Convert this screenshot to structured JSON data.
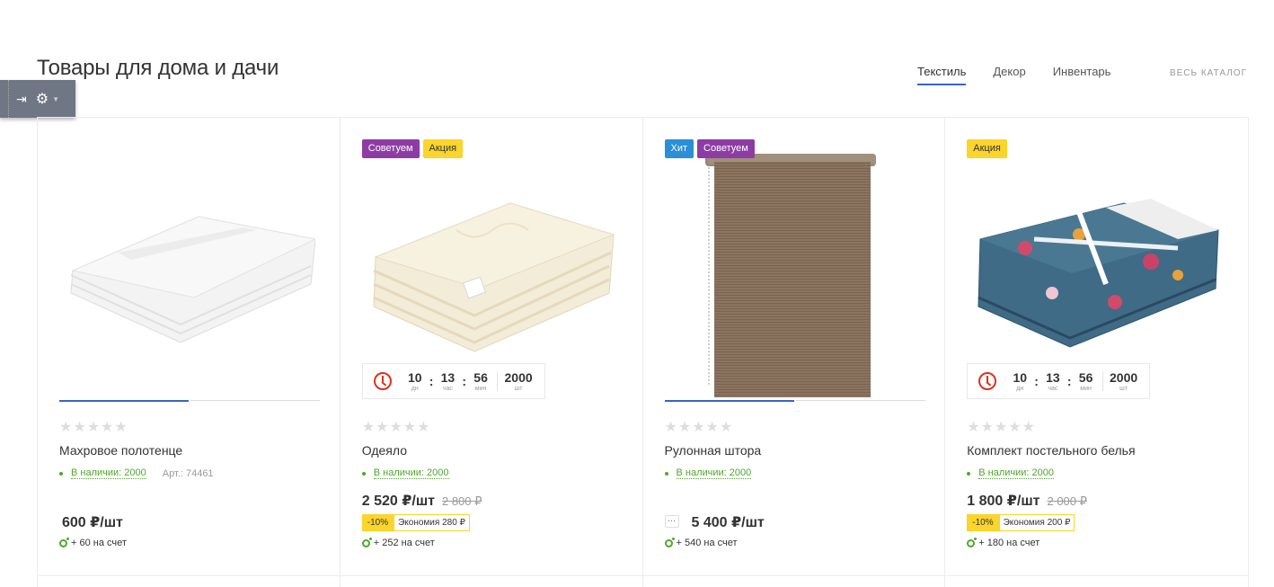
{
  "section": {
    "title": "Товары для дома и дачи",
    "tabs": [
      "Текстиль",
      "Декор",
      "Инвентарь"
    ],
    "active_tab": "Текстиль",
    "all_catalog": "ВЕСЬ КАТАЛОГ"
  },
  "admin_bar": {
    "pin_icon": "pin-icon",
    "gear_icon": "gear-icon"
  },
  "colors": {
    "accent": "#3a63c7",
    "green": "#4fa62c",
    "purple": "#8e3ca5",
    "yellow": "#fbd52b",
    "blue": "#2b8fd6",
    "red": "#e0301e"
  },
  "products": [
    {
      "badges": [],
      "title": "Махровое полотенце",
      "stock": "В наличии: 2000",
      "article": "Арт.: 74461",
      "price": "600 ₽/шт",
      "bonus": "+ 60 на счет",
      "rating_stars": "★★★★★"
    },
    {
      "badges": [
        "Советуем",
        "Акция"
      ],
      "title": "Одеяло",
      "stock": "В наличии: 2000",
      "price": "2 520 ₽/шт",
      "old_price": "2 800 ₽",
      "discount": "-10%",
      "saving": "Экономия 280 ₽",
      "bonus": "+ 252 на счет",
      "rating_stars": "★★★★★",
      "timer": {
        "days": "10",
        "days_lbl": "дн",
        "hours": "13",
        "hours_lbl": "час",
        "mins": "56",
        "mins_lbl": "мин",
        "qty": "2000",
        "qty_lbl": "шт"
      }
    },
    {
      "badges": [
        "Хит",
        "Советуем"
      ],
      "title": "Рулонная штора",
      "stock": "В наличии: 2000",
      "price": "5 400 ₽/шт",
      "more": "···",
      "bonus": "+ 540 на счет",
      "rating_stars": "★★★★★"
    },
    {
      "badges": [
        "Акция"
      ],
      "title": "Комплект постельного белья",
      "stock": "В наличии: 2000",
      "price": "1 800 ₽/шт",
      "old_price": "2 000 ₽",
      "discount": "-10%",
      "saving": "Экономия 200 ₽",
      "bonus": "+ 180 на счет",
      "rating_stars": "★★★★★",
      "timer": {
        "days": "10",
        "days_lbl": "дн",
        "hours": "13",
        "hours_lbl": "час",
        "mins": "56",
        "mins_lbl": "мин",
        "qty": "2000",
        "qty_lbl": "шт"
      }
    }
  ]
}
